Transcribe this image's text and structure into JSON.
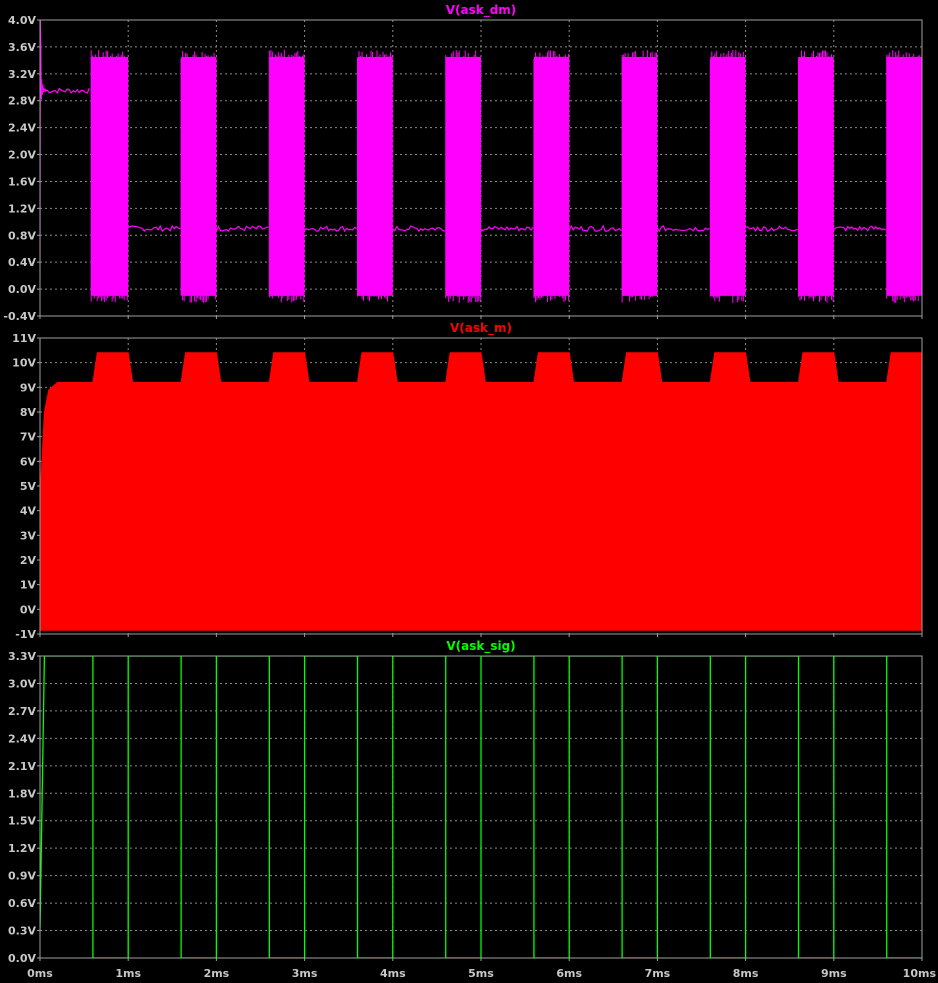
{
  "chart_data": [
    {
      "type": "line",
      "title": "V(ask_dm)",
      "color": "#ff00ff",
      "xlim": [
        0,
        10
      ],
      "ylim": [
        -0.4,
        4.0
      ],
      "yticks": [
        "-0.4V",
        "0.0V",
        "0.4V",
        "0.8V",
        "1.2V",
        "1.6V",
        "2.0V",
        "2.4V",
        "2.8V",
        "3.2V",
        "3.6V",
        "4.0V"
      ],
      "series": [
        {
          "segments": [
            {
              "x": [
                0.06,
                0.58
              ],
              "y": [
                2.95,
                2.95
              ]
            },
            {
              "x": [
                0.58,
                1.0
              ],
              "y": [
                -0.1,
                3.45
              ]
            },
            {
              "x": [
                1.0,
                1.6
              ],
              "y": [
                0.9,
                0.9
              ]
            },
            {
              "x": [
                1.6,
                2.0
              ],
              "y": [
                -0.1,
                3.45
              ]
            },
            {
              "x": [
                2.0,
                2.6
              ],
              "y": [
                0.9,
                0.9
              ]
            },
            {
              "x": [
                2.6,
                3.0
              ],
              "y": [
                -0.1,
                3.45
              ]
            },
            {
              "x": [
                3.0,
                3.6
              ],
              "y": [
                0.9,
                0.9
              ]
            },
            {
              "x": [
                3.6,
                4.0
              ],
              "y": [
                -0.1,
                3.45
              ]
            },
            {
              "x": [
                4.0,
                4.6
              ],
              "y": [
                0.9,
                0.9
              ]
            },
            {
              "x": [
                4.6,
                5.0
              ],
              "y": [
                -0.1,
                3.45
              ]
            },
            {
              "x": [
                5.0,
                5.6
              ],
              "y": [
                0.9,
                0.9
              ]
            },
            {
              "x": [
                5.6,
                6.0
              ],
              "y": [
                -0.1,
                3.45
              ]
            },
            {
              "x": [
                6.0,
                6.6
              ],
              "y": [
                0.9,
                0.9
              ]
            },
            {
              "x": [
                6.6,
                7.0
              ],
              "y": [
                -0.1,
                3.45
              ]
            },
            {
              "x": [
                7.0,
                7.6
              ],
              "y": [
                0.9,
                0.9
              ]
            },
            {
              "x": [
                7.6,
                8.0
              ],
              "y": [
                -0.1,
                3.45
              ]
            },
            {
              "x": [
                8.0,
                8.6
              ],
              "y": [
                0.9,
                0.9
              ]
            },
            {
              "x": [
                8.6,
                9.0
              ],
              "y": [
                -0.1,
                3.45
              ]
            },
            {
              "x": [
                9.0,
                9.6
              ],
              "y": [
                0.9,
                0.9
              ]
            },
            {
              "x": [
                9.6,
                10.0
              ],
              "y": [
                -0.1,
                3.45
              ]
            }
          ]
        }
      ]
    },
    {
      "type": "area",
      "title": "V(ask_m)",
      "color": "#ff0000",
      "xlim": [
        0,
        10
      ],
      "ylim": [
        -1,
        11
      ],
      "yticks": [
        "-1V",
        "0V",
        "1V",
        "2V",
        "3V",
        "4V",
        "5V",
        "6V",
        "7V",
        "8V",
        "9V",
        "10V",
        "11V"
      ],
      "series": [
        {
          "envelope_x": [
            0,
            0.05,
            0.1,
            0.2,
            0.6,
            0.65,
            1.0,
            1.05,
            1.6,
            1.65,
            2.0,
            2.05,
            2.6,
            2.65,
            3.0,
            3.05,
            3.6,
            3.65,
            4.0,
            4.05,
            4.6,
            4.65,
            5.0,
            5.05,
            5.6,
            5.65,
            6.0,
            6.05,
            6.6,
            6.65,
            7.0,
            7.05,
            7.6,
            7.65,
            8.0,
            8.05,
            8.6,
            8.65,
            9.0,
            9.05,
            9.6,
            9.65,
            10.0
          ],
          "upper": [
            4.5,
            8.0,
            8.9,
            9.2,
            9.2,
            10.4,
            10.4,
            9.2,
            9.2,
            10.4,
            10.4,
            9.2,
            9.2,
            10.4,
            10.4,
            9.2,
            9.2,
            10.4,
            10.4,
            9.2,
            9.2,
            10.4,
            10.4,
            9.2,
            9.2,
            10.4,
            10.4,
            9.2,
            9.2,
            10.4,
            10.4,
            9.2,
            9.2,
            10.4,
            10.4,
            9.2,
            9.2,
            10.4,
            10.4,
            9.2,
            9.2,
            10.4,
            10.4
          ],
          "lower": -0.85
        }
      ]
    },
    {
      "type": "line",
      "title": "V(ask_sig)",
      "color": "#00ff00",
      "xlim": [
        0,
        10
      ],
      "ylim": [
        0.0,
        3.3
      ],
      "yticks": [
        "0.0V",
        "0.3V",
        "0.6V",
        "0.9V",
        "1.2V",
        "1.5V",
        "1.8V",
        "2.1V",
        "2.4V",
        "2.7V",
        "3.0V",
        "3.3V"
      ],
      "series": [
        {
          "x": [
            0,
            0.05,
            0.6,
            0.6,
            1.0,
            1.0,
            1.6,
            1.6,
            2.0,
            2.0,
            2.6,
            2.6,
            3.0,
            3.0,
            3.6,
            3.6,
            4.0,
            4.0,
            4.6,
            4.6,
            5.0,
            5.0,
            5.6,
            5.6,
            6.0,
            6.0,
            6.6,
            6.6,
            7.0,
            7.0,
            7.6,
            7.6,
            8.0,
            8.0,
            8.6,
            8.6,
            9.0,
            9.0,
            9.6,
            9.6,
            10.0
          ],
          "y": [
            0.3,
            3.3,
            3.3,
            0.0,
            0.0,
            3.3,
            3.3,
            0.0,
            0.0,
            3.3,
            3.3,
            0.0,
            0.0,
            3.3,
            3.3,
            0.0,
            0.0,
            3.3,
            3.3,
            0.0,
            0.0,
            3.3,
            3.3,
            0.0,
            0.0,
            3.3,
            3.3,
            0.0,
            0.0,
            3.3,
            3.3,
            0.0,
            0.0,
            3.3,
            3.3,
            0.0,
            0.0,
            3.3,
            3.3,
            0.0,
            0.0
          ]
        }
      ]
    }
  ],
  "xticks": [
    "0ms",
    "1ms",
    "2ms",
    "3ms",
    "4ms",
    "5ms",
    "6ms",
    "7ms",
    "8ms",
    "9ms",
    "10ms"
  ],
  "grid": true
}
